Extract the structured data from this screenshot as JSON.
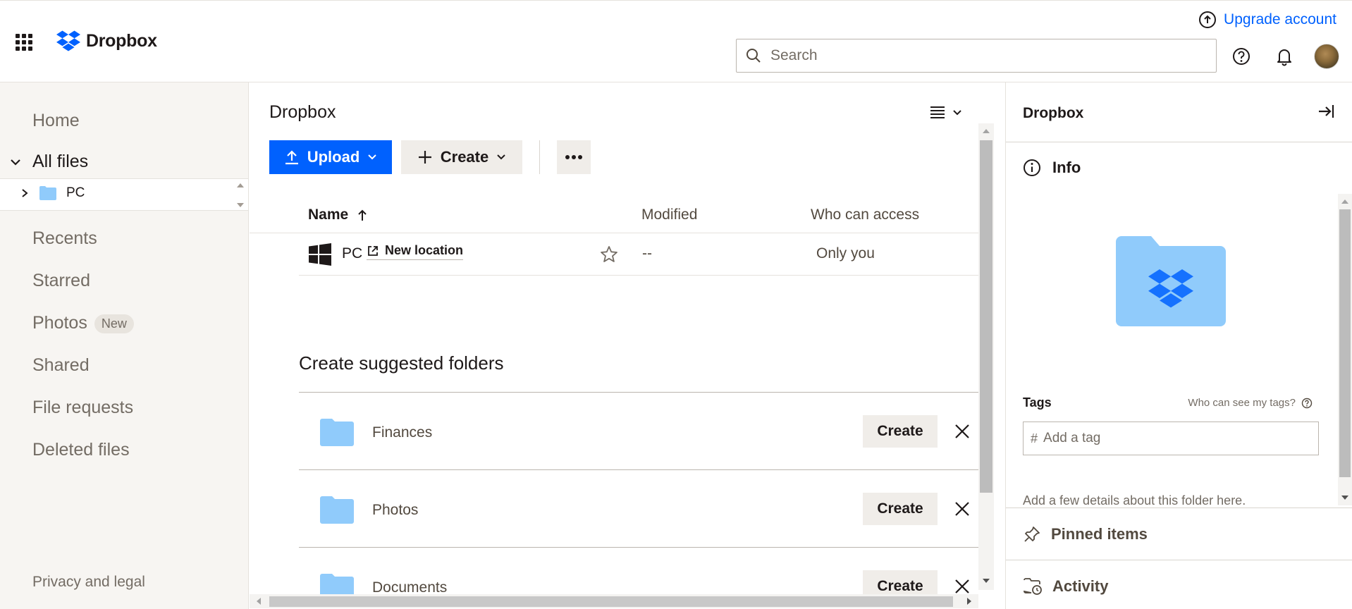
{
  "header": {
    "logo_text": "Dropbox",
    "upgrade_label": "Upgrade account",
    "search_placeholder": "Search"
  },
  "sidebar": {
    "home": "Home",
    "all_files": "All files",
    "tree_item": "PC",
    "recents": "Recents",
    "starred": "Starred",
    "photos": "Photos",
    "photos_badge": "New",
    "shared": "Shared",
    "file_requests": "File requests",
    "deleted_files": "Deleted files",
    "privacy": "Privacy and legal"
  },
  "main": {
    "title": "Dropbox",
    "upload_label": "Upload",
    "create_label": "Create",
    "columns": {
      "name": "Name",
      "modified": "Modified",
      "access": "Who can access"
    },
    "rows": [
      {
        "name": "PC",
        "link_label": "New location",
        "modified": "--",
        "access": "Only you"
      }
    ],
    "suggested": {
      "title": "Create suggested folders",
      "create_label": "Create",
      "items": [
        {
          "name": "Finances"
        },
        {
          "name": "Photos"
        },
        {
          "name": "Documents"
        }
      ]
    }
  },
  "panel": {
    "title": "Dropbox",
    "info_label": "Info",
    "tags_label": "Tags",
    "tags_help": "Who can see my tags?",
    "tag_placeholder": "Add a tag",
    "tag_hash": "#",
    "description": "Add a few details about this folder here.",
    "pinned_label": "Pinned items",
    "activity_label": "Activity"
  },
  "colors": {
    "accent": "#0061fe",
    "folder": "#90cbfb",
    "folder_dark": "#0061fe",
    "sidebar_bg": "#f7f5f2"
  }
}
